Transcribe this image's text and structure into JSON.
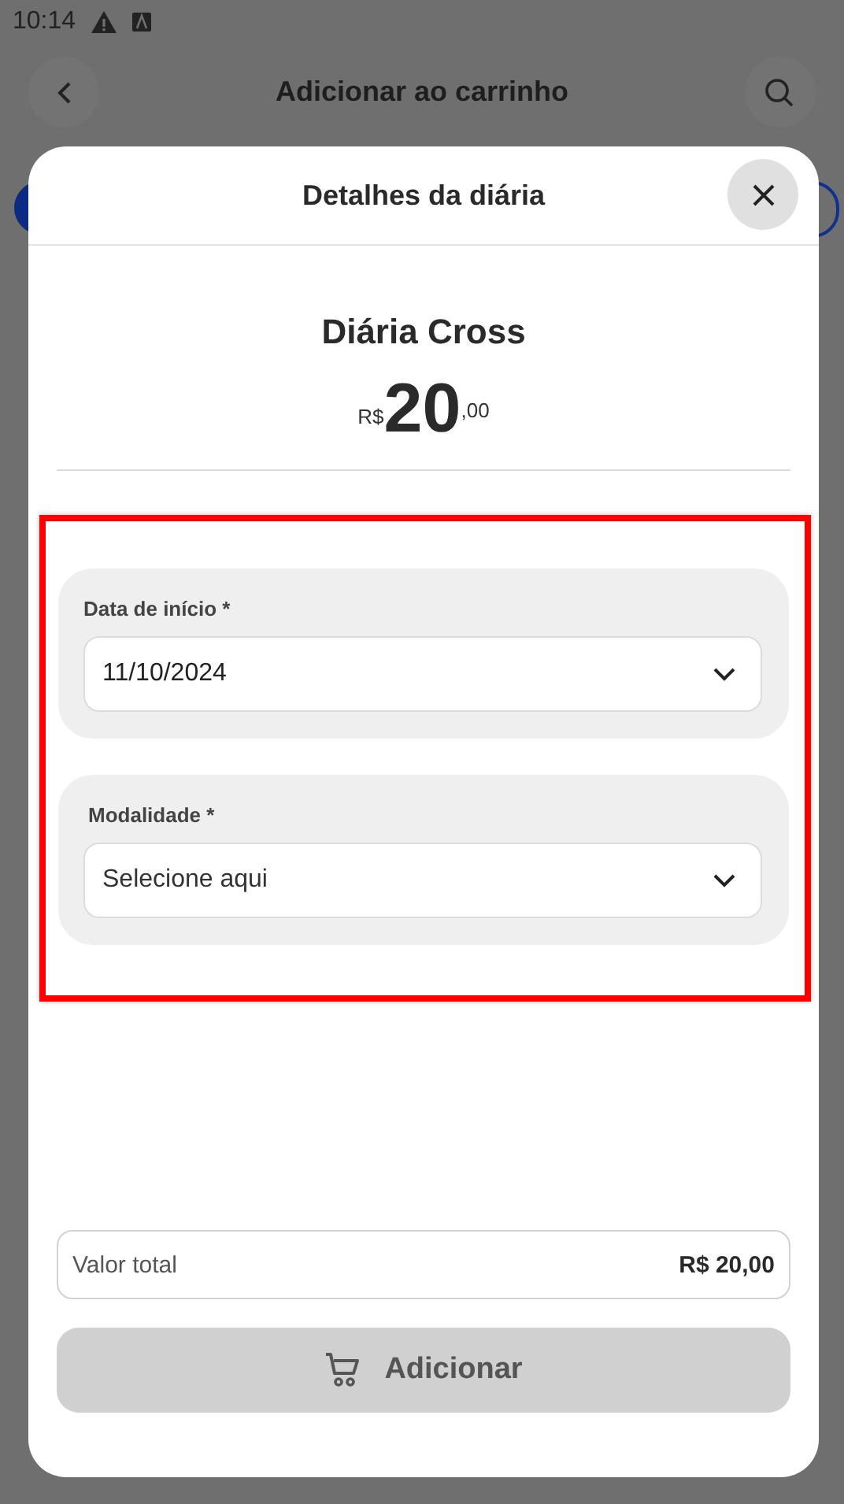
{
  "status_bar": {
    "time": "10:14"
  },
  "header": {
    "title": "Adicionar ao carrinho"
  },
  "modal": {
    "title": "Detalhes da diária",
    "product": "Diária Cross",
    "price": {
      "currency": "R$",
      "whole": "20",
      "cents": ",00"
    },
    "fields": [
      {
        "label": "Data de início *",
        "value": "11/10/2024"
      },
      {
        "label": "Modalidade  *",
        "placeholder": "Selecione aqui"
      }
    ],
    "total": {
      "label": "Valor total",
      "value": "R$ 20,00"
    },
    "add_button": {
      "label": "Adicionar",
      "disabled": true
    }
  },
  "annotation": {
    "kind": "highlight",
    "color": "#ff0000"
  }
}
